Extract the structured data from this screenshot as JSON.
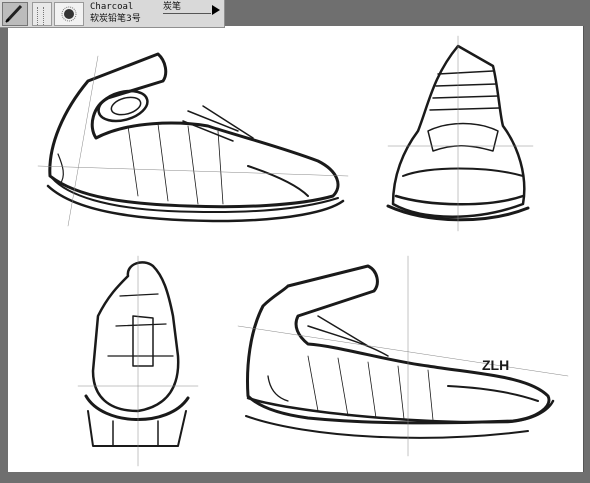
{
  "brush_panel": {
    "brush_name": "Charcoal",
    "brush_alias": "炭笔",
    "brush_variant": "软炭铅笔3号",
    "tools": [
      "charcoal-brush-icon",
      "brush-tip-icon",
      "stroke-preview-icon"
    ],
    "flyout_icon": "triangle-right-icon"
  },
  "sketch": {
    "signature": "ZLH",
    "views": [
      "lateral-side-view",
      "front-view",
      "back-view",
      "medial-three-quarter-view"
    ]
  },
  "colors": {
    "background": "#6f6f6f",
    "canvas": "#ffffff",
    "panel": "#d9d9d9",
    "ink": "#1a1a1a"
  }
}
